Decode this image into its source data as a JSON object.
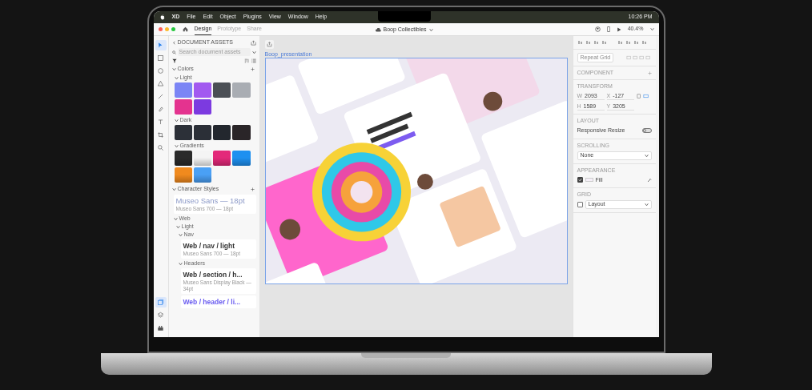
{
  "menubar": {
    "app": "XD",
    "menus": [
      "File",
      "Edit",
      "Object",
      "Plugins",
      "View",
      "Window",
      "Help"
    ],
    "time": "10:26 PM"
  },
  "toolbar": {
    "tabs": [
      {
        "label": "Design",
        "selected": true
      },
      {
        "label": "Prototype",
        "selected": false
      },
      {
        "label": "Share",
        "selected": false
      }
    ],
    "document_title": "Boop Collectibles",
    "zoom": "40.4%"
  },
  "tools": [
    {
      "kind": "select",
      "selected": true
    },
    {
      "kind": "rectangle",
      "selected": false
    },
    {
      "kind": "ellipse",
      "selected": false
    },
    {
      "kind": "polygon",
      "selected": false
    },
    {
      "kind": "line",
      "selected": false
    },
    {
      "kind": "pen",
      "selected": false
    },
    {
      "kind": "text",
      "selected": false
    },
    {
      "kind": "artboard",
      "selected": false
    },
    {
      "kind": "zoom",
      "selected": false
    }
  ],
  "panels": [
    {
      "kind": "assets",
      "selected": true
    },
    {
      "kind": "layers",
      "selected": false
    },
    {
      "kind": "plugins",
      "selected": false
    }
  ],
  "assets": {
    "title": "DOCUMENT ASSETS",
    "search": {
      "placeholder": "Search document assets"
    },
    "colors": {
      "title": "Colors",
      "groups": [
        {
          "name": "Light",
          "expanded": true,
          "swatches": [
            {
              "kind": "solid",
              "color": "#7b85f5"
            },
            {
              "kind": "solid",
              "color": "#a259f0"
            },
            {
              "kind": "solid",
              "color": "#4b4f55"
            },
            {
              "kind": "solid",
              "color": "#a9adb3"
            },
            {
              "kind": "solid",
              "color": "#e4338f"
            },
            {
              "kind": "solid",
              "color": "#7c3ae0"
            }
          ]
        },
        {
          "name": "Dark",
          "expanded": true,
          "swatches": [
            {
              "kind": "solid",
              "color": "#2c3038"
            },
            {
              "kind": "solid",
              "color": "#2b2f37"
            },
            {
              "kind": "solid",
              "color": "#23272e"
            },
            {
              "kind": "solid",
              "color": "#2a2528"
            }
          ]
        },
        {
          "name": "Gradients",
          "expanded": true,
          "swatches": [
            {
              "kind": "gradient",
              "color": "#2a2a2a"
            },
            {
              "kind": "gradient",
              "color": "#f4f4f4"
            },
            {
              "kind": "gradient",
              "color": "#e3297a"
            },
            {
              "kind": "gradient",
              "color": "#1e90f0"
            },
            {
              "kind": "gradient",
              "color": "#f08a1e"
            },
            {
              "kind": "gradient",
              "color": "#4aa0f5"
            }
          ]
        }
      ]
    },
    "character_styles": {
      "title": "Character Styles",
      "items": [
        {
          "kind": "preview",
          "name": "Museo Sans — 18pt",
          "detail": "Museo Sans 700 — 18pt"
        },
        {
          "kind": "folder",
          "name": "Web",
          "expanded": true,
          "children": [
            {
              "kind": "folder",
              "name": "Light",
              "expanded": true,
              "children": [
                {
                  "kind": "folder",
                  "name": "Nav",
                  "expanded": true,
                  "children": [
                    {
                      "kind": "style",
                      "name": "Web / nav / light",
                      "detail": "Museo Sans 700 — 18pt"
                    }
                  ]
                },
                {
                  "kind": "folder",
                  "name": "Headers",
                  "expanded": true,
                  "children": [
                    {
                      "kind": "style",
                      "name": "Web / section / h...",
                      "detail": "Museo Sans Display Black — 34pt"
                    },
                    {
                      "kind": "accent",
                      "name": "Web / header / li..."
                    }
                  ]
                }
              ]
            }
          ]
        }
      ]
    }
  },
  "canvas": {
    "artboard_label": "Boop_presentation"
  },
  "inspector": {
    "repeat_grid": "Repeat Grid",
    "component": "COMPONENT",
    "transform": {
      "title": "TRANSFORM",
      "fields": [
        {
          "label": "W",
          "value": "2093"
        },
        {
          "label": "X",
          "value": "-127"
        },
        {
          "label": "H",
          "value": "1589"
        },
        {
          "label": "Y",
          "value": "3205"
        }
      ]
    },
    "layout": {
      "title": "LAYOUT",
      "responsive_resize": "Responsive Resize",
      "on": false
    },
    "scrolling": {
      "title": "SCROLLING",
      "value": "None"
    },
    "appearance": {
      "title": "APPEARANCE",
      "fill_label": "Fill",
      "checked": true
    },
    "grid": {
      "title": "GRID",
      "value": "Layout",
      "checked": false
    }
  }
}
